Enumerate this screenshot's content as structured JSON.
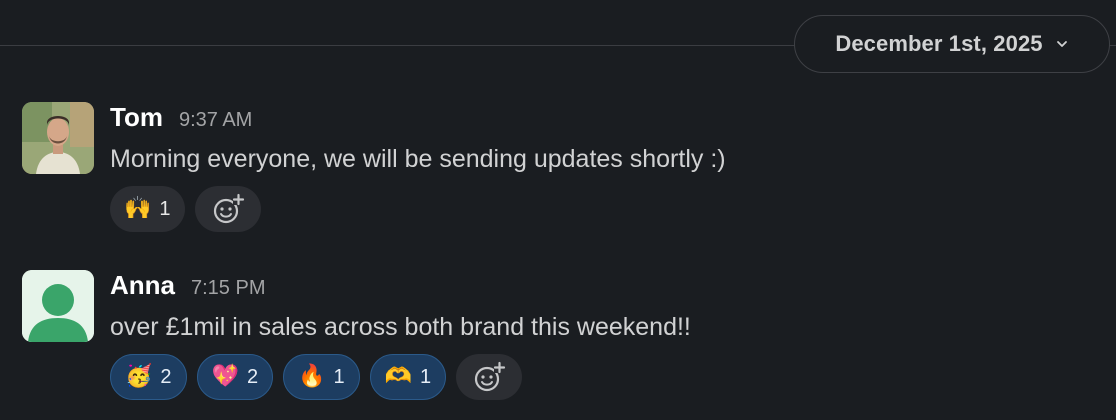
{
  "date_divider": {
    "label": "December 1st, 2025",
    "icon": "chevron-down-icon"
  },
  "messages": [
    {
      "sender": "Tom",
      "time": "9:37 AM",
      "avatar": "profile-photo",
      "text": "Morning everyone, we will be sending updates shortly :)",
      "reactions": [
        {
          "emoji": "🙌",
          "count": "1",
          "reacted_by_me": false
        }
      ],
      "add_reaction_icon": "add-reaction-icon"
    },
    {
      "sender": "Anna",
      "time": "7:15 PM",
      "avatar": "default-user-avatar",
      "text": "over £1mil in sales across both brand this weekend!!",
      "reactions": [
        {
          "emoji": "🥳",
          "count": "2",
          "reacted_by_me": true
        },
        {
          "emoji": "💖",
          "count": "2",
          "reacted_by_me": true
        },
        {
          "emoji": "🔥",
          "count": "1",
          "reacted_by_me": true
        },
        {
          "emoji": "🫶",
          "count": "1",
          "reacted_by_me": true
        }
      ],
      "add_reaction_icon": "add-reaction-icon"
    }
  ],
  "colors": {
    "background": "#1a1d21",
    "reacted_pill": "#1d3d61",
    "neutral_pill": "#2c2e33",
    "default_avatar": "#3aa56a"
  }
}
